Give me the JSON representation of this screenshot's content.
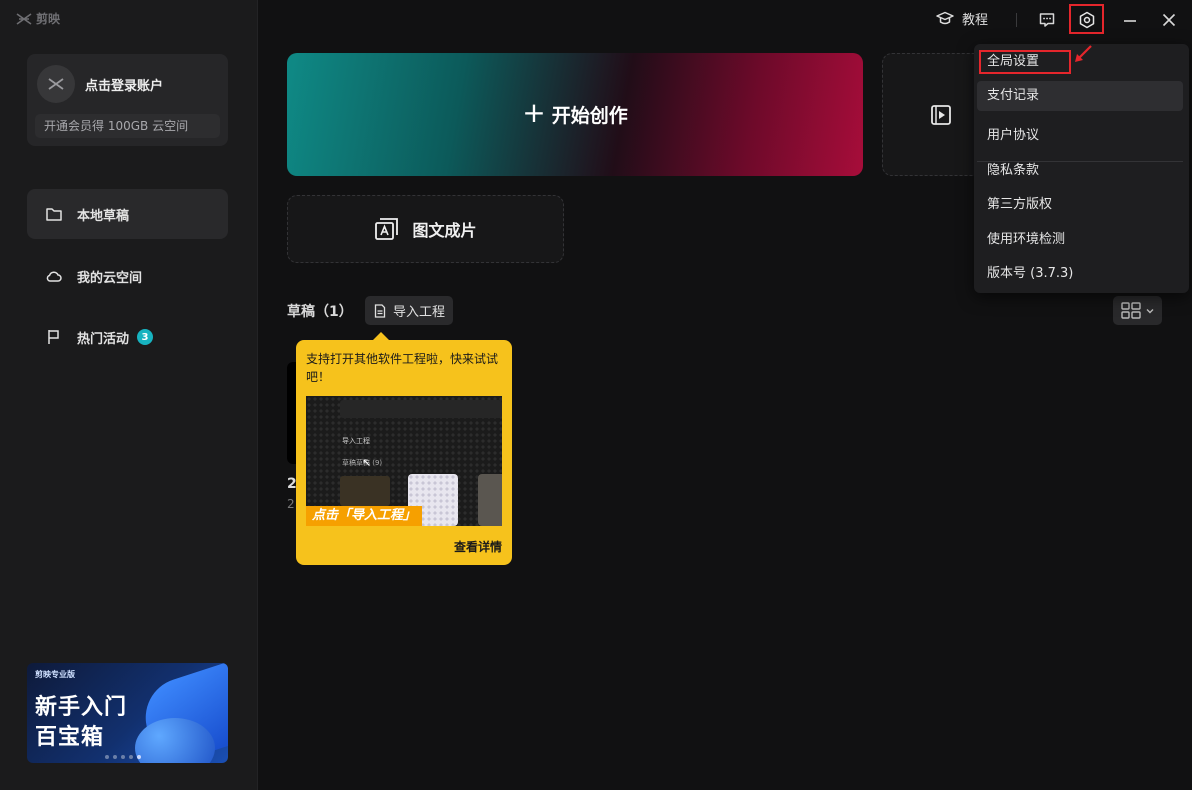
{
  "app": {
    "brand": "剪映"
  },
  "account": {
    "login_label": "点击登录账户",
    "promo": "开通会员得 100GB 云空间"
  },
  "sidebar": {
    "items": [
      {
        "label": "本地草稿",
        "icon": "folder-icon",
        "active": true
      },
      {
        "label": "我的云空间",
        "icon": "cloud-icon"
      },
      {
        "label": "热门活动",
        "icon": "flag-icon",
        "badge": "3"
      }
    ]
  },
  "banner": {
    "brand": "剪映专业版",
    "line1": "新手入门",
    "line2": "百宝箱"
  },
  "titlebar": {
    "tutorial_label": "教程",
    "icons": [
      "feedback-icon",
      "settings-icon",
      "minimize-icon",
      "close-icon"
    ]
  },
  "main": {
    "create_label": "开始创作",
    "tuwen_label": "图文成片",
    "drafts_title": "草稿（1）",
    "import_label": "导入工程",
    "draft": {
      "name": "2",
      "meta": "2"
    }
  },
  "tooltip": {
    "text": "支持打开其他软件工程啦，快来试试吧！",
    "img_import": "导入工程",
    "img_draft": "草稿草稿 (9)",
    "img_caption": "点击「导入工程」",
    "link": "查看详情"
  },
  "menu": {
    "items": [
      "全局设置",
      "支付记录",
      "用户协议",
      "隐私条款",
      "第三方版权",
      "使用环境检测",
      "版本号 (3.7.3)"
    ]
  },
  "colors": {
    "accent_teal": "#0f8a86",
    "accent_red": "#a70d3a",
    "highlight": "#e5262c",
    "tooltip": "#f6c21c",
    "badge": "#17b3c0"
  }
}
